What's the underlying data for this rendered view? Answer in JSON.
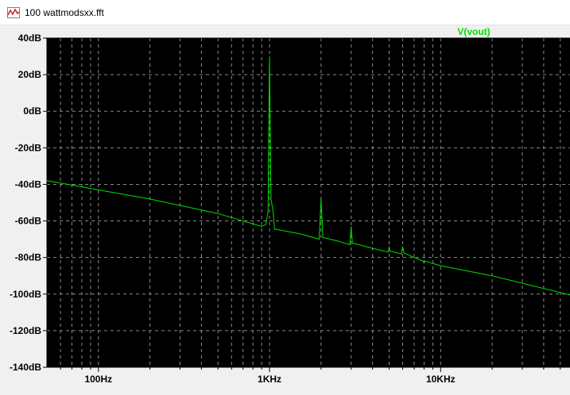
{
  "window": {
    "title": "100 wattmodsxx.fft",
    "icon": "waveform-icon"
  },
  "colors": {
    "plot_background": "#000000",
    "trace": "#00e000",
    "grid": "#8a8a8a",
    "frame": "#f0f0f0"
  },
  "chart_data": {
    "type": "line",
    "title": "",
    "xlabel": "",
    "ylabel": "",
    "x_scale": "log",
    "xlim": [
      50,
      57000
    ],
    "ylim": [
      -140,
      40
    ],
    "grid": true,
    "legend_position": "top-right",
    "yticks": [
      40,
      20,
      0,
      -20,
      -40,
      -60,
      -80,
      -100,
      -120,
      -140
    ],
    "ytick_labels": [
      "40dB",
      "20dB",
      "0dB",
      "-20dB",
      "-40dB",
      "-60dB",
      "-80dB",
      "-100dB",
      "-120dB",
      "-140dB"
    ],
    "xticks": [
      100,
      1000,
      10000
    ],
    "xtick_labels": [
      "100Hz",
      "1KHz",
      "10KHz"
    ],
    "series": [
      {
        "name": "V(vout)",
        "x": [
          50,
          100,
          200,
          500,
          900,
          950,
          980,
          1000,
          1020,
          1050,
          1070,
          1100,
          1500,
          1950,
          2000,
          2050,
          2500,
          2950,
          3000,
          3050,
          4000,
          4950,
          5000,
          5050,
          5900,
          6000,
          6100,
          7000,
          7900,
          8000,
          8100,
          10000,
          20000,
          57000
        ],
        "y": [
          -38,
          -43,
          -48,
          -56,
          -63,
          -62,
          -55,
          30,
          -48,
          -55,
          -64.5,
          -64.6,
          -67,
          -70,
          -48,
          -69,
          -71,
          -73,
          -63,
          -72,
          -75,
          -77,
          -74,
          -76.5,
          -78,
          -74,
          -77.5,
          -80,
          -82,
          -83,
          -82,
          -84.5,
          -90,
          -100.5
        ]
      }
    ]
  }
}
